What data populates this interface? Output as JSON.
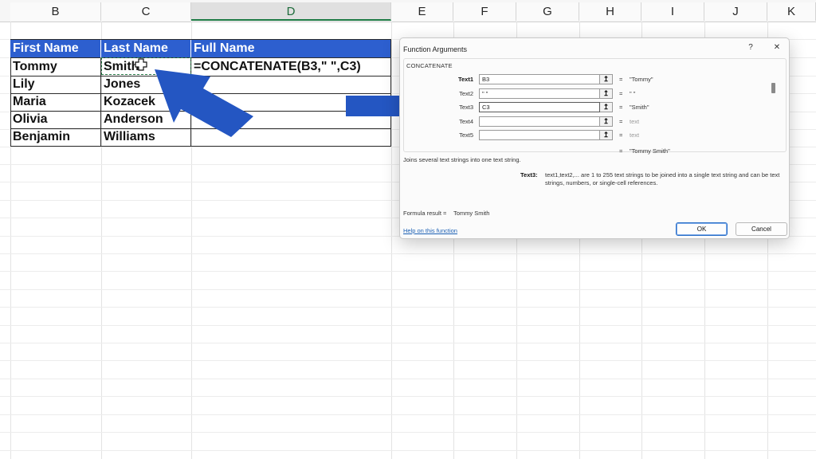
{
  "columns": [
    "B",
    "C",
    "D",
    "E",
    "F",
    "G",
    "H",
    "I",
    "J",
    "K"
  ],
  "table": {
    "headers": [
      "First Name",
      "Last Name",
      "Full Name"
    ],
    "rows": [
      [
        "Tommy",
        "Smith",
        "=CONCATENATE(B3,\" \",C3)"
      ],
      [
        "Lily",
        "Jones",
        ""
      ],
      [
        "Maria",
        "Kozacek",
        ""
      ],
      [
        "Olivia",
        "Anderson",
        ""
      ],
      [
        "Benjamin",
        "Williams",
        ""
      ]
    ]
  },
  "colors": {
    "header_fill": "#2d5fcf",
    "arrow": "#2456c2",
    "selection": "#1e7b45"
  },
  "cursor_icon": "cell-plus-cursor-icon",
  "dialog": {
    "title": "Function Arguments",
    "help_button": "?",
    "close_button": "✕",
    "function_name": "CONCATENATE",
    "args": [
      {
        "label": "Text1",
        "value": "B3",
        "result": "\"Tommy\""
      },
      {
        "label": "Text2",
        "value": "\" \"",
        "result": "\" \""
      },
      {
        "label": "Text3",
        "value": "C3",
        "result": "\"Smith\""
      },
      {
        "label": "Text4",
        "value": "",
        "result": "text"
      },
      {
        "label": "Text5",
        "value": "",
        "result": "text"
      }
    ],
    "overall_result": "\"Tommy Smith\"",
    "description": "Joins several text strings into one text string.",
    "arg_help_name": "Text3:",
    "arg_help_text": "text1,text2,... are 1 to 255 text strings to be joined into a single text string and can be text strings, numbers, or single-cell references.",
    "formula_result_label": "Formula result =",
    "formula_result_value": "Tommy Smith",
    "help_link": "Help on this function",
    "ok_label": "OK",
    "cancel_label": "Cancel"
  }
}
